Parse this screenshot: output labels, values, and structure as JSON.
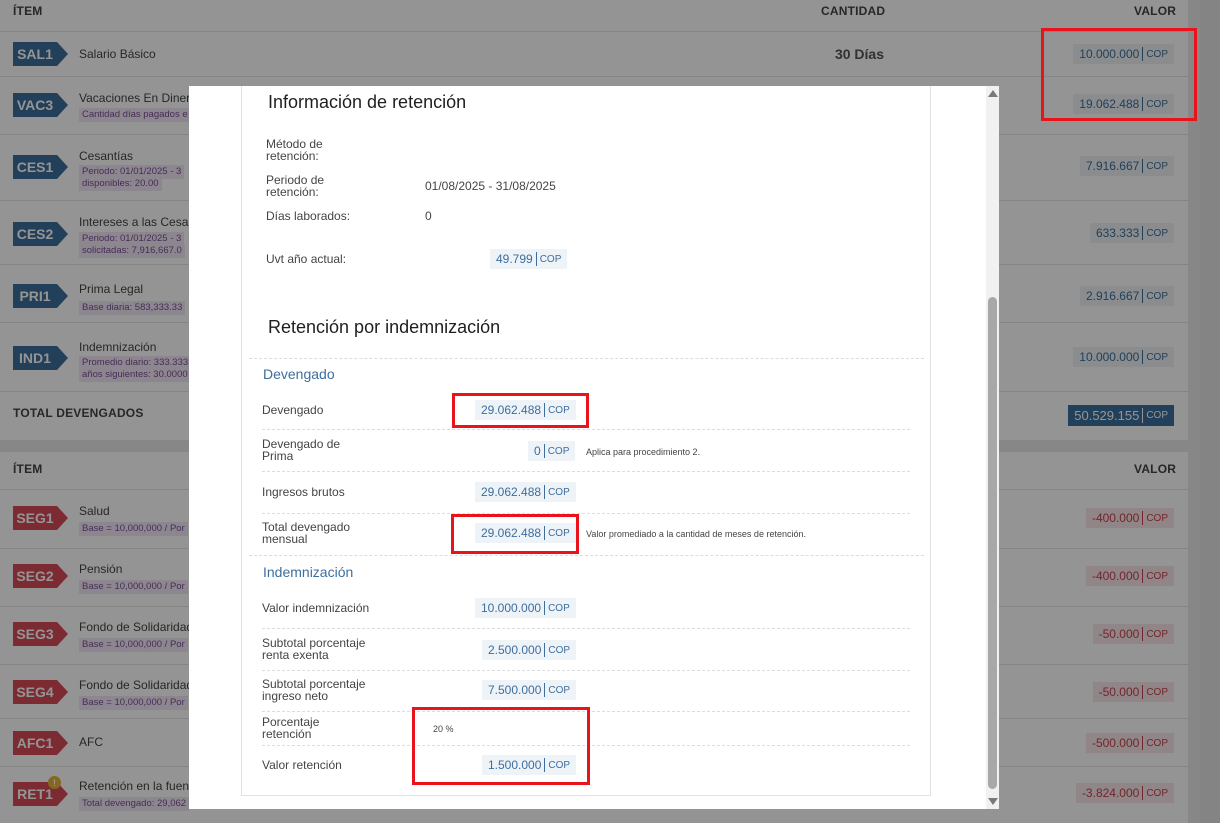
{
  "devengados": {
    "header": {
      "item": "ÍTEM",
      "cantidad": "CANTIDAD",
      "valor": "VALOR"
    },
    "rows": [
      {
        "code": "SAL1",
        "name": "Salario Básico",
        "sub": "",
        "qty": "30 Días",
        "amount": "10.000.000",
        "currency": "COP"
      },
      {
        "code": "VAC3",
        "name": "Vacaciones En Dinero",
        "sub": "Cantidad días pagados e",
        "qty": "",
        "amount": "19.062.488",
        "currency": "COP"
      },
      {
        "code": "CES1",
        "name": "Cesantías",
        "sub": "Periodo: 01/01/2025 - 3",
        "sub2": "disponibles: 20.00",
        "qty": "",
        "amount": "7.916.667",
        "currency": "COP"
      },
      {
        "code": "CES2",
        "name": "Intereses a las Cesan",
        "sub": "Periodo: 01/01/2025 - 3",
        "sub2": "solicitadas: 7,916,667.0",
        "qty": "",
        "amount": "633.333",
        "currency": "COP"
      },
      {
        "code": "PRI1",
        "name": "Prima Legal",
        "sub": "Base diaria: 583,333.33",
        "qty": "",
        "amount": "2.916.667",
        "currency": "COP"
      },
      {
        "code": "IND1",
        "name": "Indemnización",
        "sub": "Promedio diario: 333.333",
        "sub2": "años siguientes: 30.0000",
        "qty": "",
        "amount": "10.000.000",
        "currency": "COP"
      }
    ],
    "total_label": "TOTAL DEVENGADOS",
    "total_amount": "50.529.155",
    "total_currency": "COP"
  },
  "deducciones": {
    "header": {
      "item": "ÍTEM",
      "valor": "VALOR"
    },
    "rows": [
      {
        "code": "SEG1",
        "name": "Salud",
        "sub": "Base = 10,000,000 / Por",
        "amount": "-400.000",
        "currency": "COP"
      },
      {
        "code": "SEG2",
        "name": "Pensión",
        "sub": "Base = 10,000,000 / Por",
        "amount": "-400.000",
        "currency": "COP"
      },
      {
        "code": "SEG3",
        "name": "Fondo de Solidaridad",
        "sub": "Base = 10,000,000 / Por",
        "amount": "-50.000",
        "currency": "COP"
      },
      {
        "code": "SEG4",
        "name": "Fondo de Solidaridad",
        "sub": "Base = 10,000,000 / Por",
        "amount": "-50.000",
        "currency": "COP"
      },
      {
        "code": "AFC1",
        "name": "AFC",
        "sub": "",
        "amount": "-500.000",
        "currency": "COP"
      },
      {
        "code": "RET1",
        "name": "Retención en la fuent",
        "sub": "Total devengado: 29,062",
        "amount": "-3.824.000",
        "currency": "COP",
        "warn": "!"
      }
    ]
  },
  "modal": {
    "info_title": "Información de retención",
    "metodo_label": "Método de retención:",
    "metodo_value": "",
    "periodo_label": "Periodo de retención:",
    "periodo_value": "01/08/2025 - 31/08/2025",
    "dias_label": "Días laborados:",
    "dias_value": "0",
    "uvt_label": "Uvt año actual:",
    "uvt_amount": "49.799",
    "uvt_currency": "COP",
    "ind_title": "Retención por indemnización",
    "devengado_section": "Devengado",
    "devengado_label": "Devengado",
    "devengado_amount": "29.062.488",
    "dev_prima_label": "Devengado de Prima",
    "dev_prima_amount": "0",
    "dev_prima_note": "Aplica para procedimiento 2.",
    "ingresos_label": "Ingresos brutos",
    "ingresos_amount": "29.062.488",
    "total_mensual_label": "Total devengado mensual",
    "total_mensual_amount": "29.062.488",
    "total_mensual_note": "Valor promediado a la cantidad de meses de retención.",
    "indem_section": "Indemnización",
    "valor_ind_label": "Valor indemnización",
    "valor_ind_amount": "10.000.000",
    "sub_exenta_label": "Subtotal porcentaje renta exenta",
    "sub_exenta_amount": "2.500.000",
    "sub_neto_label": "Subtotal porcentaje ingreso neto",
    "sub_neto_amount": "7.500.000",
    "porc_label": "Porcentaje retención",
    "porc_value": "20 %",
    "valor_ret_label": "Valor retención",
    "valor_ret_amount": "1.500.000",
    "currency": "COP"
  },
  "colors": {
    "accent": "#3d6e9c",
    "negative": "#d64a56",
    "highlight": "#e8131b"
  },
  "icons": {
    "scroll_up": "chevron-up-icon",
    "scroll_down": "chevron-down-icon",
    "warning": "warning-icon"
  }
}
